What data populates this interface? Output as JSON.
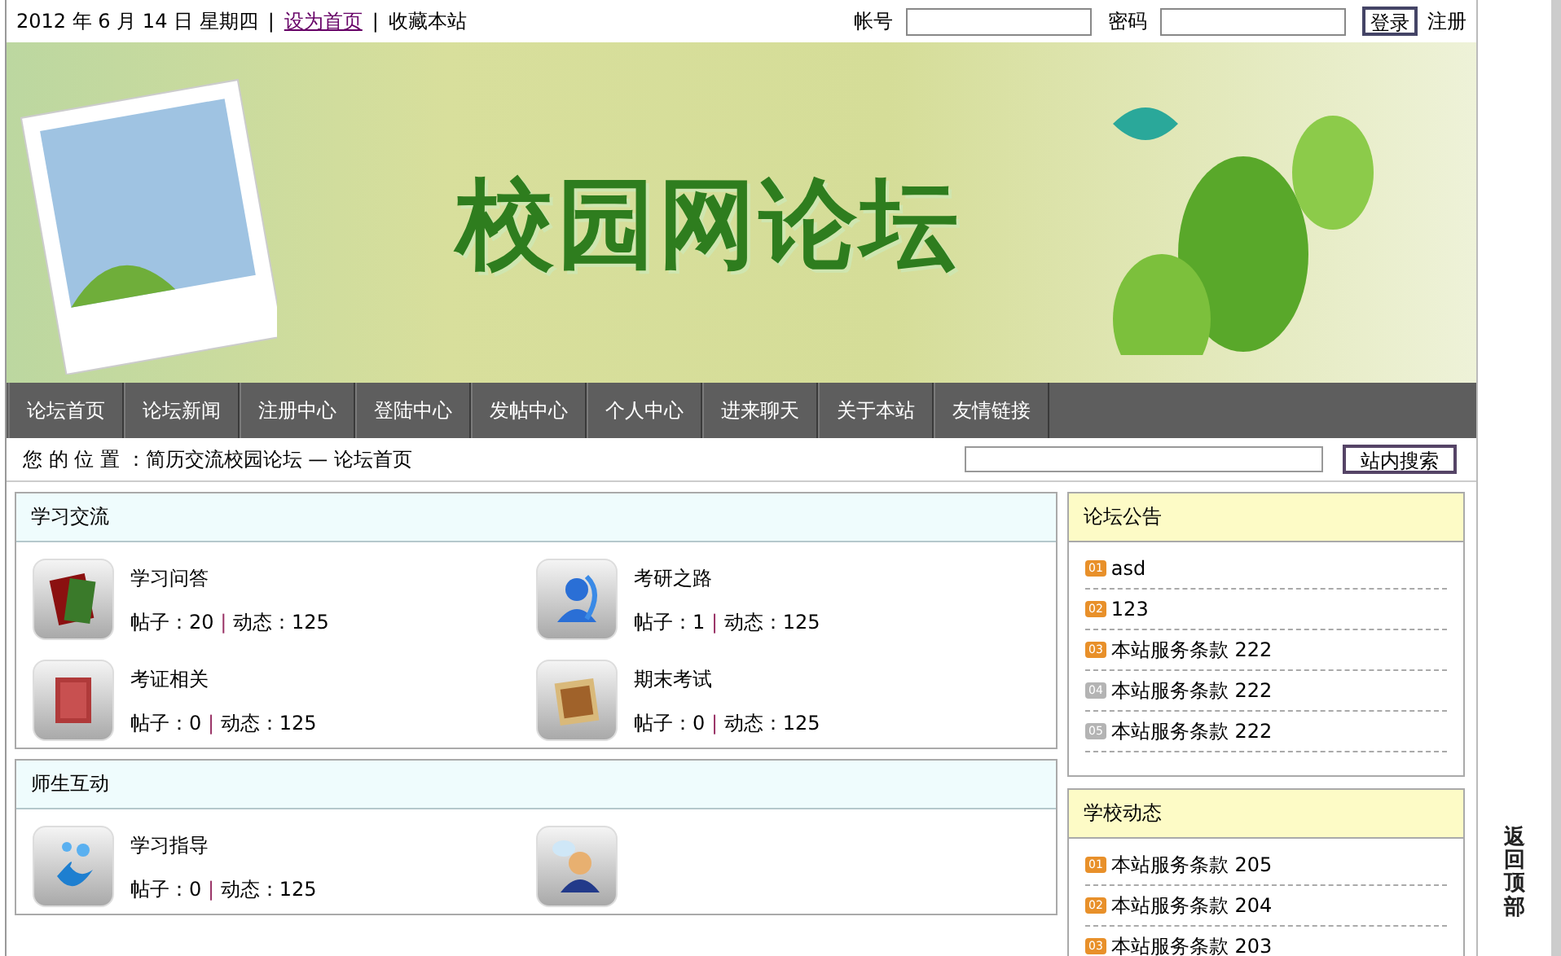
{
  "top_bar": {
    "date": "2012 年 6 月 14 日 星期四",
    "separators": [
      "|",
      "|"
    ],
    "links": [
      "设为首页",
      "收藏本站"
    ],
    "account_label": "帐号",
    "password_label": "密码",
    "login_button": "登录",
    "register_link": "注册"
  },
  "banner": {
    "title": "校园网论坛"
  },
  "nav": [
    {
      "label": "论坛首页"
    },
    {
      "label": "论坛新闻"
    },
    {
      "label": "注册中心"
    },
    {
      "label": "登陆中心"
    },
    {
      "label": "发帖中心"
    },
    {
      "label": "个人中心"
    },
    {
      "label": "进来聊天"
    },
    {
      "label": "关于本站"
    },
    {
      "label": "友情链接"
    }
  ],
  "location": {
    "label": "您 的 位 置 ：简历交流校园论坛 — 论坛首页",
    "search_button": "站内搜索"
  },
  "sections": [
    {
      "title": "学习交流",
      "forums": [
        {
          "kind": "books",
          "name": "学习问答",
          "posts": "帖子：20",
          "separator": "|",
          "activity": "动态：125"
        },
        {
          "kind": "graduate",
          "name": "考研之路",
          "posts": "帖子：1",
          "separator": "|",
          "activity": "动态：125"
        },
        {
          "kind": "dictionary",
          "name": "考证相关",
          "posts": "帖子：0",
          "separator": "|",
          "activity": "动态：125"
        },
        {
          "kind": "newspaper",
          "name": "期末考试",
          "posts": "帖子：0",
          "separator": "|",
          "activity": "动态：125"
        }
      ]
    },
    {
      "title": "师生互动",
      "forums": [
        {
          "kind": "splash",
          "name": "学习指导",
          "posts": "帖子：0",
          "separator": "|",
          "activity": "动态：125"
        },
        {
          "kind": "person"
        }
      ]
    }
  ],
  "side_panels": [
    {
      "title": "论坛公告",
      "items": [
        {
          "number": "01",
          "color": "#e8902a",
          "text": "asd"
        },
        {
          "number": "02",
          "color": "#e8902a",
          "text": "123"
        },
        {
          "number": "03",
          "color": "#e8902a",
          "text": "本站服务条款  222"
        },
        {
          "number": "04",
          "color": "#b4b4b4",
          "text": "本站服务条款  222"
        },
        {
          "number": "05",
          "color": "#b4b4b4",
          "text": "本站服务条款  222"
        }
      ]
    },
    {
      "title": "学校动态",
      "items": [
        {
          "number": "01",
          "color": "#e8902a",
          "text": "本站服务条款  205"
        },
        {
          "number": "02",
          "color": "#e8902a",
          "text": "本站服务条款  204"
        },
        {
          "number": "03",
          "color": "#e8902a",
          "text": "本站服务条款  203"
        }
      ]
    }
  ],
  "back_to_top": "返回顶部"
}
